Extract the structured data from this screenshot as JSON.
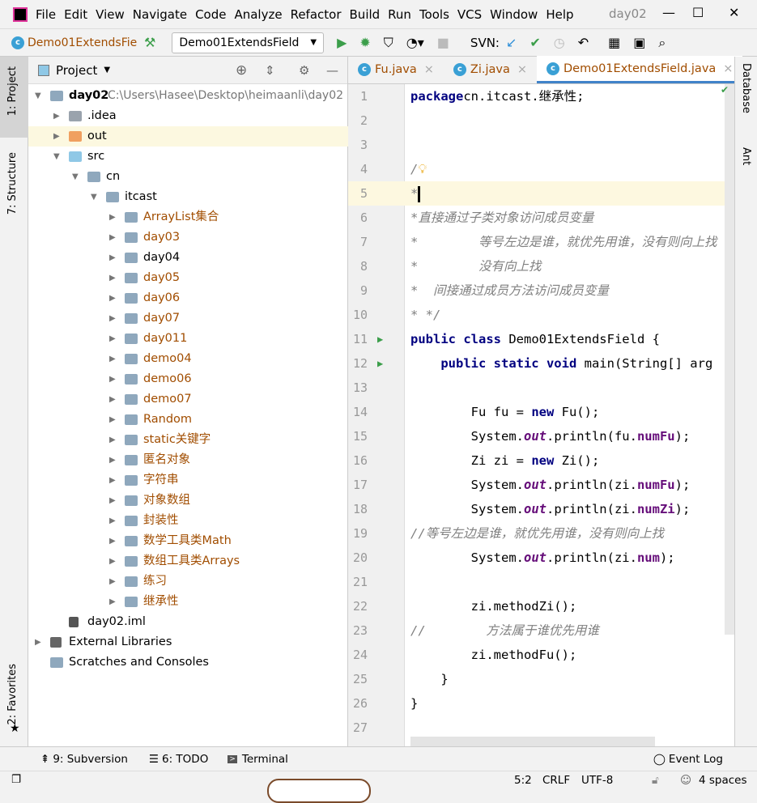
{
  "menubar": {
    "items": [
      "File",
      "Edit",
      "View",
      "Navigate",
      "Code",
      "Analyze",
      "Refactor",
      "Build",
      "Run",
      "Tools",
      "VCS",
      "Window",
      "Help"
    ],
    "project_title": "day02"
  },
  "toolbar": {
    "breadcrumb": "Demo01ExtendsFiel",
    "run_config": "Demo01ExtendsField",
    "svn_label": "SVN:"
  },
  "left_strip": {
    "project_tab": "1: Project",
    "structure_tab": "7: Structure",
    "favorites_tab": "2: Favorites"
  },
  "right_strip": {
    "database_tab": "Database",
    "ant_tab": "Ant"
  },
  "project_panel": {
    "title": "Project",
    "tree": [
      {
        "label": "day02",
        "path": "C:\\Users\\Hasee\\Desktop\\heimaanli\\day02",
        "level": 0,
        "icon": "module",
        "expanded": true
      },
      {
        "label": ".idea",
        "level": 1,
        "icon": "idea",
        "expanded": false
      },
      {
        "label": "out",
        "level": 1,
        "icon": "out",
        "expanded": false,
        "selected": true
      },
      {
        "label": "src",
        "level": 1,
        "icon": "src",
        "expanded": true
      },
      {
        "label": "cn",
        "level": 2,
        "icon": "package",
        "expanded": true
      },
      {
        "label": "itcast",
        "level": 3,
        "icon": "package",
        "expanded": true
      },
      {
        "label": "ArrayList集合",
        "level": 4,
        "icon": "package",
        "color": "brown"
      },
      {
        "label": "day03",
        "level": 4,
        "icon": "package",
        "color": "brown"
      },
      {
        "label": "day04",
        "level": 4,
        "icon": "package"
      },
      {
        "label": "day05",
        "level": 4,
        "icon": "package",
        "color": "brown"
      },
      {
        "label": "day06",
        "level": 4,
        "icon": "package",
        "color": "brown"
      },
      {
        "label": "day07",
        "level": 4,
        "icon": "package",
        "color": "brown"
      },
      {
        "label": "day011",
        "level": 4,
        "icon": "package",
        "color": "brown"
      },
      {
        "label": "demo04",
        "level": 4,
        "icon": "package",
        "color": "brown"
      },
      {
        "label": "demo06",
        "level": 4,
        "icon": "package",
        "color": "brown"
      },
      {
        "label": "demo07",
        "level": 4,
        "icon": "package",
        "color": "brown"
      },
      {
        "label": "Random",
        "level": 4,
        "icon": "package",
        "color": "brown"
      },
      {
        "label": "static关键字",
        "level": 4,
        "icon": "package",
        "color": "brown"
      },
      {
        "label": "匿名对象",
        "level": 4,
        "icon": "package",
        "color": "brown"
      },
      {
        "label": "字符串",
        "level": 4,
        "icon": "package",
        "color": "brown"
      },
      {
        "label": "对象数组",
        "level": 4,
        "icon": "package",
        "color": "brown"
      },
      {
        "label": "封装性",
        "level": 4,
        "icon": "package",
        "color": "brown"
      },
      {
        "label": "数学工具类Math",
        "level": 4,
        "icon": "package",
        "color": "brown"
      },
      {
        "label": "数组工具类Arrays",
        "level": 4,
        "icon": "package",
        "color": "brown"
      },
      {
        "label": "练习",
        "level": 4,
        "icon": "package",
        "color": "brown"
      },
      {
        "label": "继承性",
        "level": 4,
        "icon": "package",
        "color": "brown"
      },
      {
        "label": "day02.iml",
        "level": 1,
        "icon": "file",
        "leaf": true
      },
      {
        "label": "External Libraries",
        "level": 0,
        "icon": "lib",
        "expanded": false
      },
      {
        "label": "Scratches and Consoles",
        "level": 0,
        "icon": "scratch",
        "leaf": true
      }
    ]
  },
  "editor": {
    "tabs": [
      {
        "label": "Fu.java",
        "active": false
      },
      {
        "label": "Zi.java",
        "active": false
      },
      {
        "label": "Demo01ExtendsField.java",
        "active": true
      }
    ],
    "current_line": 5,
    "lines": [
      [
        [
          "kw",
          "package"
        ],
        [
          "",
          "cn.itcast.继承性;"
        ]
      ],
      [],
      [],
      [
        [
          "cm",
          "/"
        ]
      ],
      [
        [
          "cm",
          "*"
        ]
      ],
      [
        [
          "cm",
          "*直接通过子类对象访问成员变量"
        ]
      ],
      [
        [
          "cm",
          "*        等号左边是谁，就优先用谁，没有则向上找"
        ]
      ],
      [
        [
          "cm",
          "*        没有向上找"
        ]
      ],
      [
        [
          "cm",
          "*  间接通过成员方法访问成员变量"
        ]
      ],
      [
        [
          "cm",
          "* */"
        ]
      ],
      [
        [
          "kw",
          "public class "
        ],
        [
          "",
          "Demo01ExtendsField {"
        ]
      ],
      [
        [
          "",
          "    "
        ],
        [
          "kw",
          "public static void "
        ],
        [
          "",
          "main(String[] arg"
        ]
      ],
      [],
      [
        [
          "",
          "        Fu fu = "
        ],
        [
          "kw",
          "new "
        ],
        [
          "",
          "Fu();"
        ]
      ],
      [
        [
          "",
          "        System."
        ],
        [
          "st",
          "out"
        ],
        [
          "",
          ".println(fu."
        ],
        [
          "fld",
          "numFu"
        ],
        [
          "",
          ");"
        ]
      ],
      [
        [
          "",
          "        Zi zi = "
        ],
        [
          "kw",
          "new "
        ],
        [
          "",
          "Zi();"
        ]
      ],
      [
        [
          "",
          "        System."
        ],
        [
          "st",
          "out"
        ],
        [
          "",
          ".println(zi."
        ],
        [
          "fld",
          "numFu"
        ],
        [
          "",
          ");"
        ]
      ],
      [
        [
          "",
          "        System."
        ],
        [
          "st",
          "out"
        ],
        [
          "",
          ".println(zi."
        ],
        [
          "fld",
          "numZi"
        ],
        [
          "",
          ");"
        ]
      ],
      [
        [
          "cm",
          "//等号左边是谁，就优先用谁，没有则向上找"
        ]
      ],
      [
        [
          "",
          "        System."
        ],
        [
          "st",
          "out"
        ],
        [
          "",
          ".println(zi."
        ],
        [
          "fld",
          "num"
        ],
        [
          "",
          ");"
        ]
      ],
      [],
      [
        [
          "",
          "        zi.methodZi();"
        ]
      ],
      [
        [
          "cm",
          "//        方法属于谁优先用谁"
        ]
      ],
      [
        [
          "",
          "        zi.methodFu();"
        ]
      ],
      [
        [
          "",
          "    }"
        ]
      ],
      [
        [
          "",
          "}"
        ]
      ],
      []
    ],
    "run_markers": [
      11,
      12
    ]
  },
  "bottom_bar": {
    "subversion": "9: Subversion",
    "todo": "6: TODO",
    "terminal": "Terminal",
    "event_log": "Event Log"
  },
  "status_bar": {
    "position": "5:2",
    "line_sep": "CRLF",
    "encoding": "UTF-8",
    "indent": "4 spaces"
  }
}
